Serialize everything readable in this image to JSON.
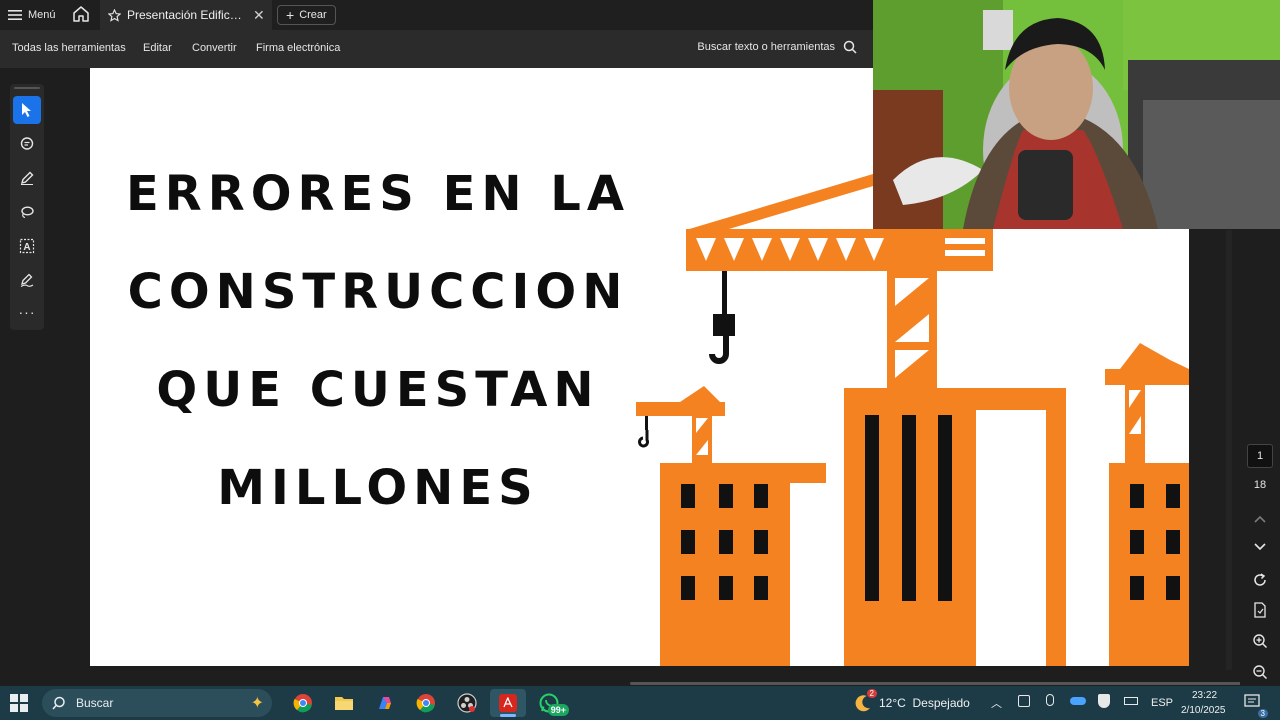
{
  "tabbar": {
    "menu_label": "Menú",
    "tab_title": "Presentación Edificac...",
    "create_label": "Crear"
  },
  "toolbar": {
    "items": [
      "Todas las herramientas",
      "Editar",
      "Convertir",
      "Firma electrónica"
    ],
    "search_label": "Buscar texto o herramientas"
  },
  "document": {
    "headline_lines": [
      "ERRORES EN LA",
      "CONSTRUCCION",
      "QUE CUESTAN",
      "MILLONES"
    ],
    "colors": {
      "orange": "#f58220",
      "dark": "#111111"
    }
  },
  "pager": {
    "current_page": "1",
    "total_pages": "18"
  },
  "taskbar": {
    "search_placeholder": "Buscar",
    "weather": "12°C  Despejado",
    "weather_badge": "2",
    "whatsapp_badge": "99+",
    "language": "ESP",
    "time": "23:22",
    "date": "2/10/2025",
    "notifications_badge": "3"
  }
}
